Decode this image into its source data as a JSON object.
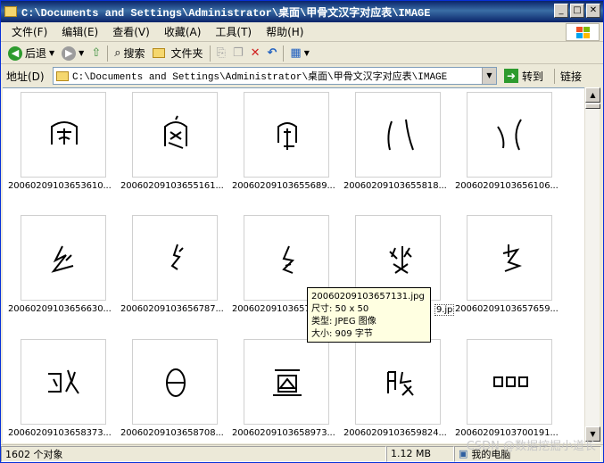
{
  "window": {
    "title": "C:\\Documents and Settings\\Administrator\\桌面\\甲骨文汉字对应表\\IMAGE",
    "controls": [
      "_",
      "□",
      "✕"
    ]
  },
  "menu": [
    "文件(F)",
    "编辑(E)",
    "查看(V)",
    "收藏(A)",
    "工具(T)",
    "帮助(H)"
  ],
  "toolbar": {
    "back": "后退",
    "search": "搜索",
    "folders": "文件夹"
  },
  "address": {
    "label": "地址(D)",
    "value": "C:\\Documents and Settings\\Administrator\\桌面\\甲骨文汉字对应表\\IMAGE",
    "go": "转到",
    "links": "链接"
  },
  "files": [
    "20060209103653610...",
    "20060209103655161...",
    "20060209103655689...",
    "20060209103655818...",
    "20060209103656106...",
    "20060209103656630...",
    "20060209103656787...",
    "20060209103657",
    "9.jp",
    "20060209103657659...",
    "20060209103658373...",
    "20060209103658708...",
    "20060209103658973...",
    "20060209103659824...",
    "20060209103700191..."
  ],
  "tooltip": {
    "name": "20060209103657131.jpg",
    "dims": "尺寸: 50 x 50",
    "type": "类型: JPEG 图像",
    "size": "大小: 909 字节"
  },
  "status": {
    "count": "1602 个对象",
    "size": "1.12 MB",
    "location": "我的电脑"
  },
  "watermark": "CSDN @数据挖掘小道长",
  "colors": {
    "titlebar": "#0a246a",
    "chrome": "#ece9d8",
    "tooltip_bg": "#ffffe1"
  }
}
